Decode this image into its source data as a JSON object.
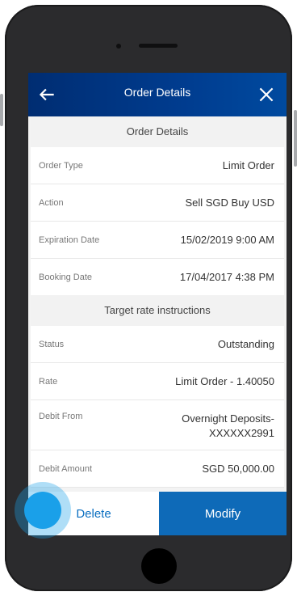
{
  "header": {
    "title": "Order Details"
  },
  "icons": {
    "back": "arrow-left-icon",
    "close": "close-icon"
  },
  "sections": [
    {
      "title": "Order Details",
      "rows": [
        {
          "label": "Order Type",
          "value": "Limit Order"
        },
        {
          "label": "Action",
          "value": "Sell SGD Buy USD"
        },
        {
          "label": "Expiration Date",
          "value": "15/02/2019 9:00 AM"
        },
        {
          "label": "Booking Date",
          "value": "17/04/2017 4:38 PM"
        }
      ]
    },
    {
      "title": "Target rate instructions",
      "rows": [
        {
          "label": "Status",
          "value": "Outstanding"
        },
        {
          "label": "Rate",
          "value": "Limit Order - 1.40050"
        },
        {
          "label": "Debit From",
          "value_line1": "Overnight Deposits-",
          "value_line2": "XXXXXX2991"
        },
        {
          "label": "Debit Amount",
          "value": "SGD 50,000.00"
        }
      ]
    }
  ],
  "actions": {
    "delete": "Delete",
    "modify": "Modify"
  },
  "colors": {
    "header_start": "#002d72",
    "header_end": "#004a9f",
    "primary": "#0e6ab8",
    "link": "#0b6fc1",
    "touch": "#1aa0e9"
  }
}
